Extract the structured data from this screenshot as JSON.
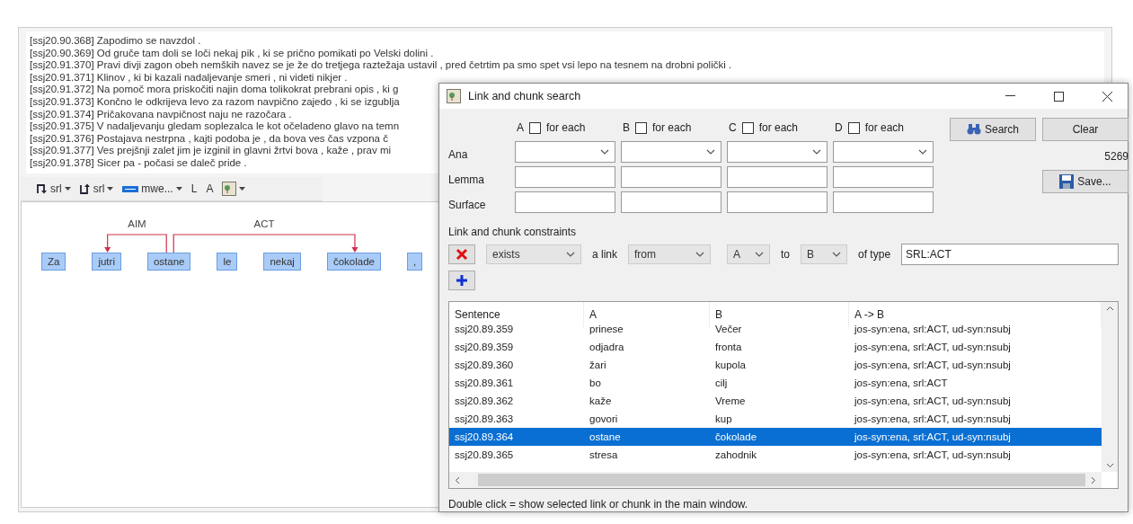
{
  "main": {
    "sentences": [
      {
        "id": "[ssj20.90.368]",
        "text": "Zapodimo se navzdol ."
      },
      {
        "id": "[ssj20.90.369]",
        "text": "Od gruče tam doli se loči nekaj pik , ki se prično pomikati po Velski dolini ."
      },
      {
        "id": "[ssj20.91.370]",
        "text": "Pravi divji zagon obeh nemških navez se je že do tretjega raztežaja ustavil , pred četrtim pa smo spet vsi lepo na tesnem na drobni polički ."
      },
      {
        "id": "[ssj20.91.371]",
        "text": "Klinov , ki bi kazali nadaljevanje smeri , ni videti nikjer ."
      },
      {
        "id": "[ssj20.91.372]",
        "text": "Na pomoč mora priskočiti najin doma tolikokrat prebrani opis , ki g"
      },
      {
        "id": "[ssj20.91.373]",
        "text": "Končno le odkrijeva levo za razom navpično zajedo , ki se izgublja"
      },
      {
        "id": "[ssj20.91.374]",
        "text": "Pričakovana navpičnost naju ne razočara ."
      },
      {
        "id": "[ssj20.91.375]",
        "text": "V nadaljevanju gledam soplezalca le kot očeladeno glavo na temn"
      },
      {
        "id": "[ssj20.91.376]",
        "text": "Postajava nestrpna , kajti podoba je , da bova ves čas vzpona č"
      },
      {
        "id": "[ssj20.91.377]",
        "text": "Ves prejšnji zalet jim je izginil in glavni žrtvi bova , kaže , prav mi"
      },
      {
        "id": "[ssj20.91.378]",
        "text": "Sicer pa - počasi se daleč pride ."
      }
    ],
    "toolbar": [
      {
        "kind": "outgoing",
        "label": "srl"
      },
      {
        "kind": "incoming",
        "label": "srl"
      },
      {
        "kind": "chunk",
        "label": "mwe..."
      },
      {
        "kind": "text",
        "label": "L"
      },
      {
        "kind": "text",
        "label": "A"
      },
      {
        "kind": "image-menu"
      }
    ],
    "diagram": {
      "tokens": [
        {
          "text": "Za",
          "kind": "word"
        },
        {
          "text": "jutri",
          "kind": "dependent",
          "link_label": "AIM"
        },
        {
          "text": "ostane",
          "kind": "head"
        },
        {
          "text": "le",
          "kind": "word"
        },
        {
          "text": "nekaj",
          "kind": "word"
        },
        {
          "text": "čokolade",
          "kind": "dependent",
          "link_label": "ACT"
        },
        {
          "text": ",",
          "kind": "word"
        }
      ]
    }
  },
  "dialog": {
    "title": "Link and chunk search",
    "columns": [
      {
        "letter": "A",
        "option": "for each",
        "checked": false
      },
      {
        "letter": "B",
        "option": "for each",
        "checked": false
      },
      {
        "letter": "C",
        "option": "for each",
        "checked": false
      },
      {
        "letter": "D",
        "option": "for each",
        "checked": false
      }
    ],
    "rows": [
      {
        "label": "Ana",
        "kind": "select"
      },
      {
        "label": "Lemma",
        "kind": "input"
      },
      {
        "label": "Surface",
        "kind": "input"
      }
    ],
    "search_button": "Search",
    "clear_button": "Clear",
    "count": "5269",
    "save_button": "Save...",
    "constraints_title": "Link and chunk constraints",
    "constraint": {
      "quantifier": "exists",
      "text_link": "a link",
      "direction": "from",
      "source": "A",
      "text_to": "to",
      "target": "B",
      "text_type": "of type",
      "type_value": "SRL:ACT"
    },
    "table": {
      "columns": [
        "Sentence",
        "A",
        "B",
        "A -> B"
      ],
      "rows": [
        {
          "cells": [
            "ssj20.89.359",
            "prinese",
            "Večer",
            "jos-syn:ena, srl:ACT, ud-syn:nsubj"
          ],
          "selected": false
        },
        {
          "cells": [
            "ssj20.89.359",
            "odjadra",
            "fronta",
            "jos-syn:ena, srl:ACT, ud-syn:nsubj"
          ],
          "selected": false
        },
        {
          "cells": [
            "ssj20.89.360",
            "žari",
            "kupola",
            "jos-syn:ena, srl:ACT, ud-syn:nsubj"
          ],
          "selected": false
        },
        {
          "cells": [
            "ssj20.89.361",
            "bo",
            "cilj",
            "jos-syn:ena, srl:ACT"
          ],
          "selected": false
        },
        {
          "cells": [
            "ssj20.89.362",
            "kaže",
            "Vreme",
            "jos-syn:ena, srl:ACT, ud-syn:nsubj"
          ],
          "selected": false
        },
        {
          "cells": [
            "ssj20.89.363",
            "govori",
            "kup",
            "jos-syn:ena, srl:ACT, ud-syn:nsubj"
          ],
          "selected": false
        },
        {
          "cells": [
            "ssj20.89.364",
            "ostane",
            "čokolade",
            "jos-syn:ena, srl:ACT, ud-syn:nsubj"
          ],
          "selected": true
        },
        {
          "cells": [
            "ssj20.89.365",
            "stresa",
            "zahodnik",
            "jos-syn:ena, srl:ACT, ud-syn:nsubj"
          ],
          "selected": false
        }
      ]
    },
    "hint": "Double click = show selected link or chunk in the main window."
  }
}
